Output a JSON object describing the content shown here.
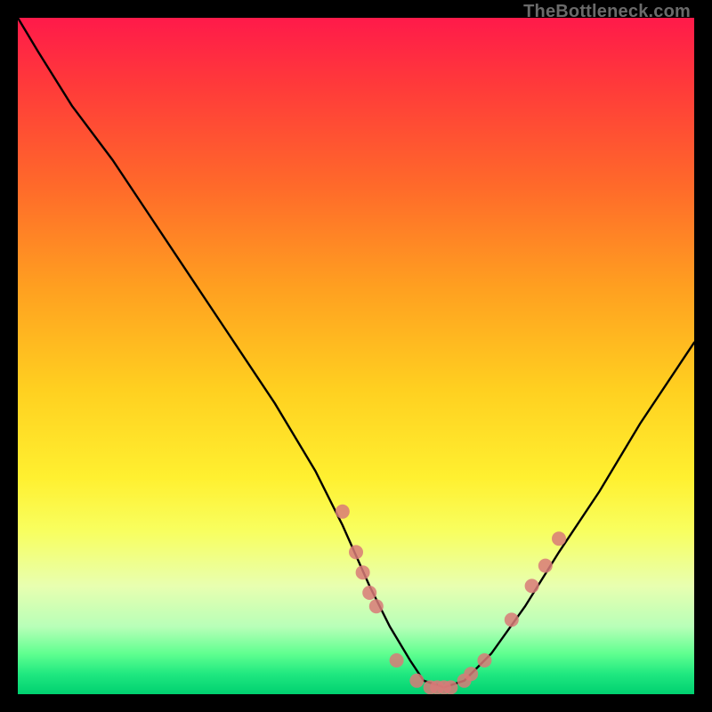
{
  "attribution": "TheBottleneck.com",
  "colors": {
    "frame": "#000000",
    "curve": "#000000",
    "dot": "#d87a78"
  },
  "chart_data": {
    "type": "line",
    "title": "",
    "xlabel": "",
    "ylabel": "",
    "xlim": [
      0,
      100
    ],
    "ylim": [
      0,
      100
    ],
    "grid": false,
    "legend": false,
    "note": "V-shaped bottleneck curve on red→green gradient; y-axis roughly maps to bottleneck percentage (top=high, bottom=0). Axes unlabeled; values estimated from pixel position.",
    "series": [
      {
        "name": "bottleneck-curve",
        "x": [
          0,
          3,
          8,
          14,
          20,
          26,
          32,
          38,
          44,
          48,
          52,
          55,
          58,
          60,
          63,
          66,
          70,
          75,
          80,
          86,
          92,
          98,
          100
        ],
        "y": [
          100,
          95,
          87,
          79,
          70,
          61,
          52,
          43,
          33,
          25,
          16,
          10,
          5,
          2,
          1,
          2,
          6,
          13,
          21,
          30,
          40,
          49,
          52
        ]
      }
    ],
    "scatter_points": {
      "name": "highlighted-points",
      "points": [
        {
          "x": 48,
          "y": 27
        },
        {
          "x": 50,
          "y": 21
        },
        {
          "x": 51,
          "y": 18
        },
        {
          "x": 52,
          "y": 15
        },
        {
          "x": 53,
          "y": 13
        },
        {
          "x": 56,
          "y": 5
        },
        {
          "x": 59,
          "y": 2
        },
        {
          "x": 61,
          "y": 1
        },
        {
          "x": 62,
          "y": 1
        },
        {
          "x": 63,
          "y": 1
        },
        {
          "x": 64,
          "y": 1
        },
        {
          "x": 66,
          "y": 2
        },
        {
          "x": 67,
          "y": 3
        },
        {
          "x": 69,
          "y": 5
        },
        {
          "x": 73,
          "y": 11
        },
        {
          "x": 76,
          "y": 16
        },
        {
          "x": 78,
          "y": 19
        },
        {
          "x": 80,
          "y": 23
        }
      ]
    }
  }
}
